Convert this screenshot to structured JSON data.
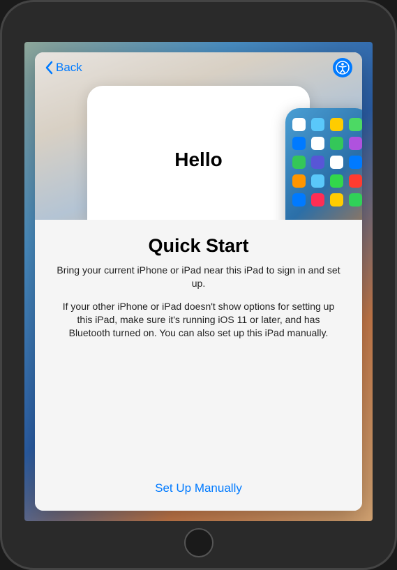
{
  "nav": {
    "back_label": "Back"
  },
  "hero": {
    "hello_text": "Hello"
  },
  "content": {
    "title": "Quick Start",
    "subtitle": "Bring your current iPhone or iPad near this iPad to sign in and set up.",
    "description": "If your other iPhone or iPad doesn't show options for setting up this iPad, make sure it's running iOS 11 or later, and has Bluetooth turned on. You can also set up this iPad manually.",
    "manual_button_label": "Set Up Manually"
  },
  "app_icons": {
    "colors": [
      "#ffffff",
      "#5ac8fa",
      "#ffcc00",
      "#4cd964",
      "#007aff",
      "#ffffff",
      "#34c759",
      "#af52de",
      "#34c759",
      "#5856d6",
      "#ffffff",
      "#007aff",
      "#ff9500",
      "#5ac8fa",
      "#32d74b",
      "#ff3b30",
      "#007aff",
      "#ff2d55",
      "#ffcc00",
      "#30d158"
    ]
  }
}
